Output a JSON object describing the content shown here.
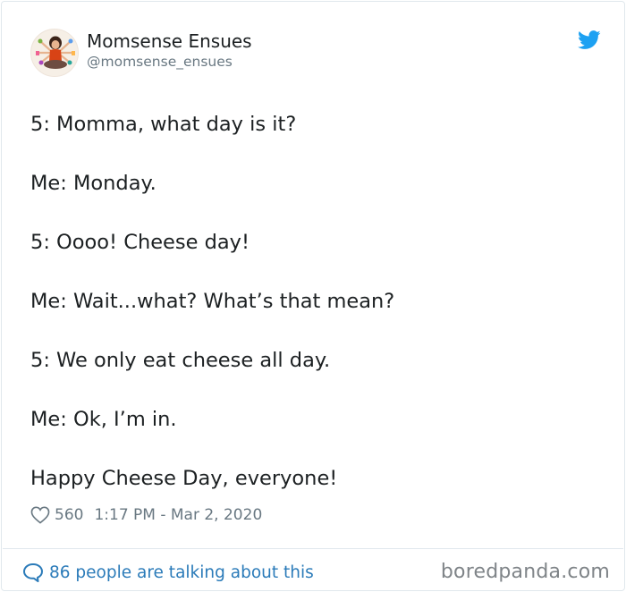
{
  "tweet": {
    "author_name": "Momsense Ensues",
    "author_handle": "@momsense_ensues",
    "avatar_icon": "meditating-mom-avatar",
    "brand_icon": "twitter-bird-icon",
    "brand_color": "#1da1f2",
    "lines": [
      "5: Momma, what day is it?",
      "Me: Monday.",
      "5: Oooo! Cheese day!",
      "Me: Wait...what? What’s that mean?",
      "5: We only eat cheese all day.",
      "Me: Ok, I’m in.",
      "Happy Cheese Day, everyone!"
    ],
    "likes": "560",
    "timestamp": "1:17 PM - Mar 2, 2020"
  },
  "footer": {
    "talking_text": "86 people are talking about this",
    "link_color": "#2b7bb9"
  },
  "watermark": "boredpanda.com"
}
